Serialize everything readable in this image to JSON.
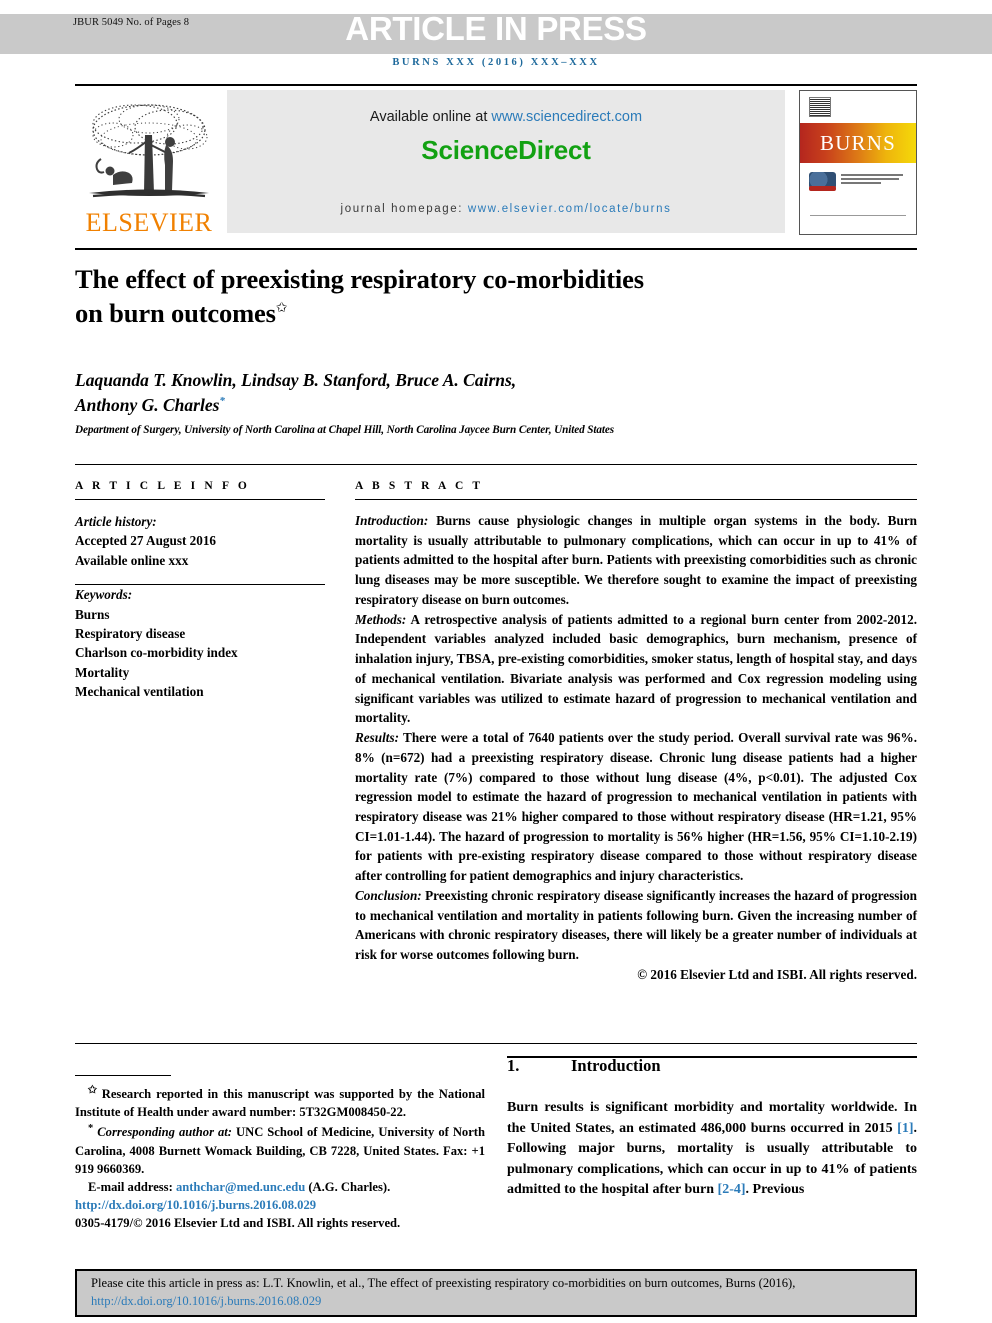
{
  "header": {
    "manuscript_id": "JBUR 5049 No. of Pages 8",
    "banner_text": "ARTICLE IN PRESS",
    "journal_ref": "burns xxx (2016) xxx–xxx"
  },
  "masthead": {
    "publisher_name": "ELSEVIER",
    "available_online_label": "Available online at ",
    "sciencedirect_url": "www.sciencedirect.com",
    "sciencedirect_logo": "ScienceDirect",
    "homepage_label": "journal homepage: ",
    "homepage_url": "www.elsevier.com/locate/burns",
    "cover_title": "BURNS"
  },
  "article": {
    "title_line1": "The effect of preexisting respiratory co-morbidities",
    "title_line2": "on burn outcomes",
    "title_marker": "✩",
    "authors_line1": "Laquanda T. Knowlin, Lindsay B. Stanford, Bruce A. Cairns,",
    "authors_line2": "Anthony G. Charles",
    "author_marker": "*",
    "affiliation": "Department of Surgery, University of North Carolina at Chapel Hill, North Carolina Jaycee Burn Center, United States"
  },
  "article_info": {
    "heading": "A R T I C L E   I N F O",
    "history_label": "Article history:",
    "history": [
      "Accepted 27 August 2016",
      "Available online xxx"
    ],
    "keywords_label": "Keywords:",
    "keywords": [
      "Burns",
      "Respiratory disease",
      "Charlson co-morbidity index",
      "Mortality",
      "Mechanical ventilation"
    ]
  },
  "abstract": {
    "heading": "A B S T R A C T",
    "introduction_label": "Introduction:",
    "introduction_text": " Burns cause physiologic changes in multiple organ systems in the body. Burn mortality is usually attributable to pulmonary complications, which can occur in up to 41% of patients admitted to the hospital after burn. Patients with preexisting comorbidities such as chronic lung diseases may be more susceptible. We therefore sought to examine the impact of preexisting respiratory disease on burn outcomes.",
    "methods_label": "Methods:",
    "methods_text": " A retrospective analysis of patients admitted to a regional burn center from 2002-2012. Independent variables analyzed included basic demographics, burn mechanism, presence of inhalation injury, TBSA, pre-existing comorbidities, smoker status, length of hospital stay, and days of mechanical ventilation. Bivariate analysis was performed and Cox regression modeling using significant variables was utilized to estimate hazard of progression to mechanical ventilation and mortality.",
    "results_label": "Results:",
    "results_text": " There were a total of 7640 patients over the study period. Overall survival rate was 96%. 8% (n=672) had a preexisting respiratory disease. Chronic lung disease patients had a higher mortality rate (7%) compared to those without lung disease (4%, p<0.01). The adjusted Cox regression model to estimate the hazard of progression to mechanical ventilation in patients with respiratory disease was 21% higher compared to those without respiratory disease (HR=1.21, 95% CI=1.01-1.44). The hazard of progression to mortality is 56% higher (HR=1.56, 95% CI=1.10-2.19) for patients with pre-existing respiratory disease compared to those without respiratory disease after controlling for patient demographics and injury characteristics.",
    "conclusion_label": "Conclusion:",
    "conclusion_text": " Preexisting chronic respiratory disease significantly increases the hazard of progression to mechanical ventilation and mortality in patients following burn. Given the increasing number of Americans with chronic respiratory diseases, there will likely be a greater number of individuals at risk for worse outcomes following burn.",
    "copyright": "© 2016 Elsevier Ltd and ISBI. All rights reserved."
  },
  "footnotes": {
    "funding_marker": "✩",
    "funding_text": " Research reported in this manuscript was supported by the National Institute of Health under award number: 5T32GM008450-22.",
    "corresponding_marker": "*",
    "corresponding_label": " Corresponding author at:",
    "corresponding_text": " UNC School of Medicine, University of North Carolina, 4008 Burnett Womack Building, CB 7228, United States. Fax: +1 919 9660369.",
    "email_label": "E-mail address: ",
    "email": "anthchar@med.unc.edu",
    "email_suffix": " (A.G. Charles).",
    "doi_url": "http://dx.doi.org/10.1016/j.burns.2016.08.029",
    "issn_line": "0305-4179/© 2016 Elsevier Ltd and ISBI. All rights reserved."
  },
  "introduction": {
    "number": "1.",
    "heading": "Introduction",
    "text_part1": "Burn results is significant morbidity and mortality worldwide. In the United States, an estimated 486,000 burns occurred in 2015 ",
    "citation1": "[1]",
    "text_part2": ". Following major burns, mortality is usually attributable to pulmonary complications, which can occur in up to 41% of patients admitted to the hospital after burn ",
    "citation2": "[2-4]",
    "text_part3": ". Previous"
  },
  "citation_box": {
    "text": "Please cite this article in press as: L.T. Knowlin, et al., The effect of preexisting respiratory co-morbidities on burn outcomes, Burns (2016), ",
    "doi_url": "http://dx.doi.org/10.1016/j.burns.2016.08.029"
  },
  "colors": {
    "link_blue": "#2b7bb9",
    "sciencedirect_green": "#12a112",
    "elsevier_orange": "#F08000",
    "band_gray": "#c9c9c9"
  }
}
